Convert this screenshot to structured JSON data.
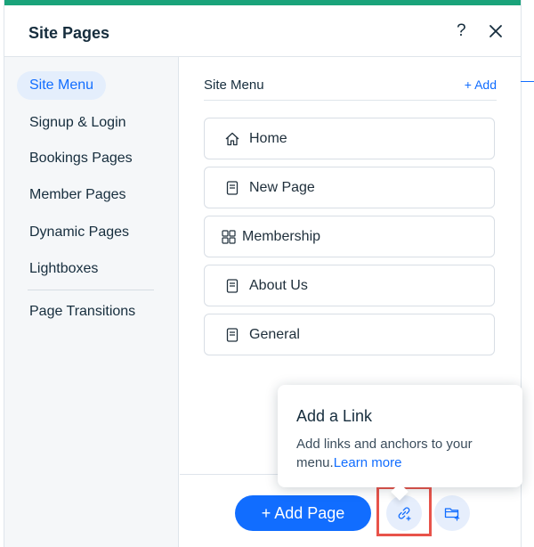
{
  "panel": {
    "title": "Site Pages",
    "help_label": "?",
    "accent_color": "#1aa37a",
    "close_icon": "close-icon"
  },
  "sidebar": {
    "items": [
      {
        "label": "Site Menu",
        "active": true
      },
      {
        "label": "Signup & Login",
        "active": false
      },
      {
        "label": "Bookings Pages",
        "active": false
      },
      {
        "label": "Member Pages",
        "active": false
      },
      {
        "label": "Dynamic Pages",
        "active": false
      },
      {
        "label": "Lightboxes",
        "active": false
      },
      {
        "label": "Page Transitions",
        "active": false
      }
    ]
  },
  "list": {
    "title": "Site Menu",
    "add_label": "+ Add",
    "pages": [
      {
        "label": "Home",
        "icon": "home-icon"
      },
      {
        "label": "New Page",
        "icon": "page-icon"
      },
      {
        "label": "Membership",
        "icon": "members-area-icon"
      },
      {
        "label": "About Us",
        "icon": "page-icon"
      },
      {
        "label": "General",
        "icon": "page-icon"
      }
    ]
  },
  "footer": {
    "add_page_label": "+ Add Page",
    "link_button_icon": "add-link-icon",
    "folder_button_icon": "add-folder-icon",
    "primary_color": "#116dff"
  },
  "tooltip": {
    "title": "Add a Link",
    "body": "Add links and anchors to your menu.",
    "link_text": "Learn more"
  }
}
